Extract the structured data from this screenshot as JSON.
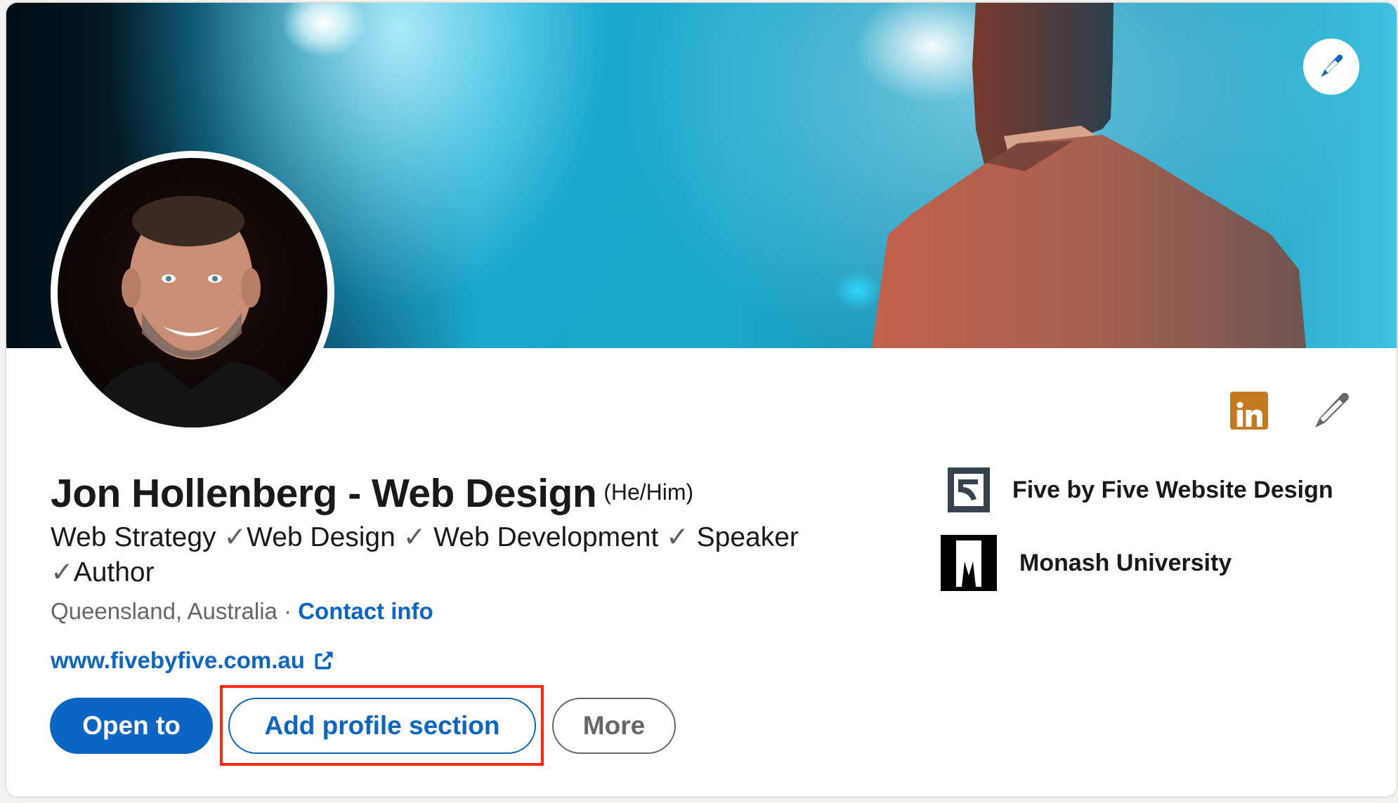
{
  "profile": {
    "name": "Jon Hollenberg - Web Design",
    "pronouns": "(He/Him)",
    "headline": {
      "line1_parts": [
        "Web Strategy ",
        "✓",
        "Web Design ",
        "✓",
        " Web Development ",
        "✓",
        " Speaker"
      ],
      "line2_parts": [
        "✓",
        "Author"
      ]
    },
    "location": "Queensland, Australia",
    "separator": " · ",
    "contact_info_label": "Contact info",
    "website": "www.fivebyfive.com.au"
  },
  "actions": {
    "open_to_label": "Open to",
    "add_profile_section_label": "Add profile section",
    "more_label": "More"
  },
  "organizations": [
    {
      "name": "Five by Five Website Design",
      "logo": "five-by-five-logo"
    },
    {
      "name": "Monash University",
      "logo": "monash-logo"
    }
  ],
  "icons": {
    "edit_banner": "pencil-icon",
    "linkedin_badge": "linkedin-icon",
    "linkedin_badge_text": "in",
    "edit_intro": "pencil-icon",
    "website_external": "external-link-icon"
  },
  "colors": {
    "brand_blue": "#0a66c2",
    "linkedin_badge": "#c47a1e",
    "highlight": "#ff2a10",
    "page_background": "#f3f2ef"
  }
}
